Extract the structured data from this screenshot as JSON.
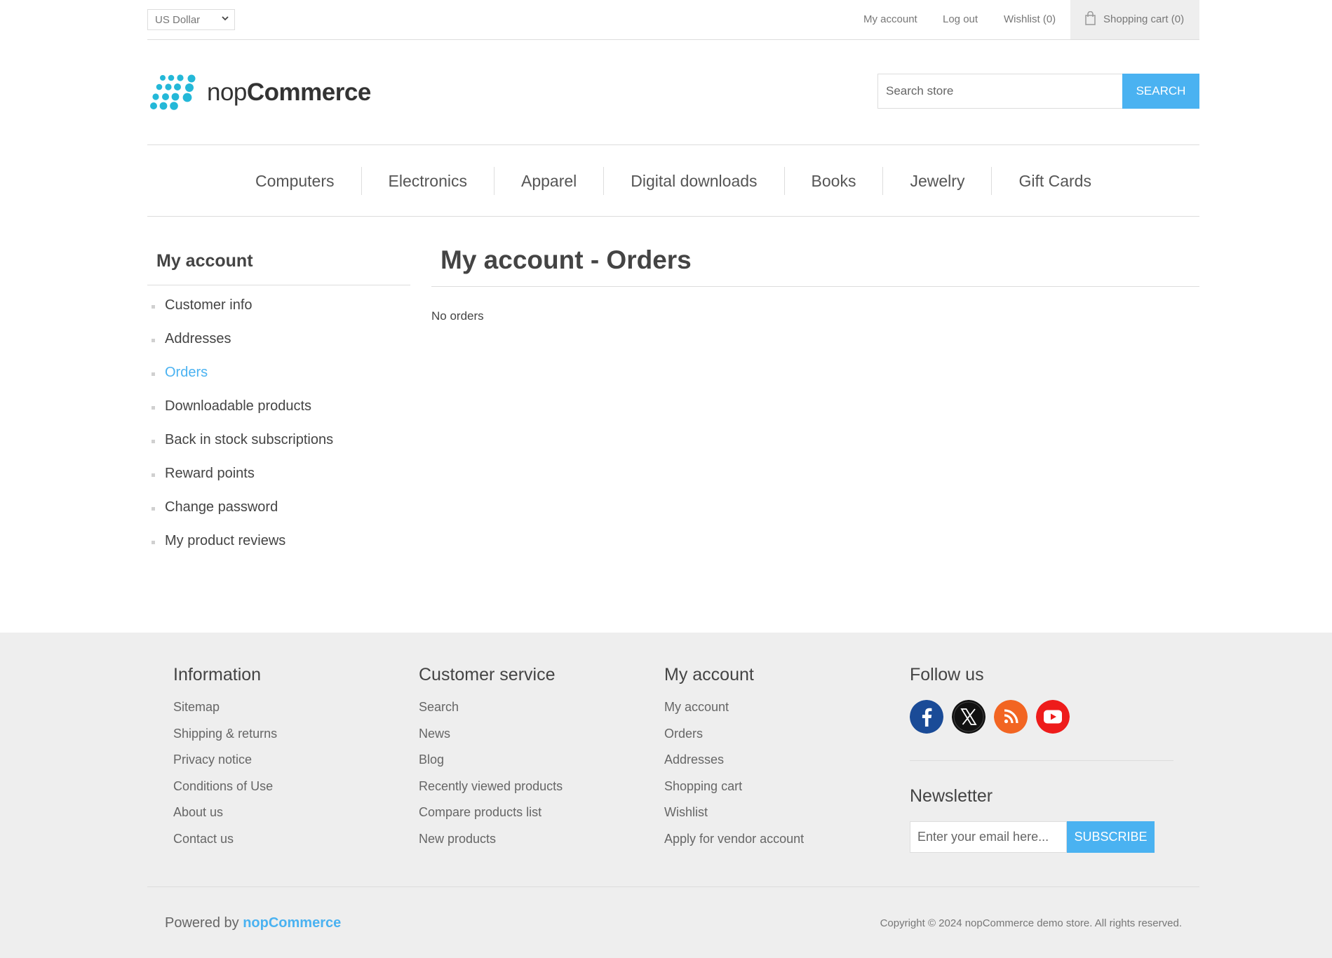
{
  "header_links": {
    "currency": "US Dollar",
    "my_account": "My account",
    "log_out": "Log out",
    "wishlist": "Wishlist (0)",
    "shopping_cart": "Shopping cart (0)"
  },
  "header": {
    "logo_prefix": "nop",
    "logo_suffix": "Commerce",
    "search_placeholder": "Search store",
    "search_button": "SEARCH"
  },
  "nav": [
    "Computers",
    "Electronics",
    "Apparel",
    "Digital downloads",
    "Books",
    "Jewelry",
    "Gift Cards"
  ],
  "sidebar": {
    "title": "My account",
    "items": [
      {
        "label": "Customer info",
        "active": false
      },
      {
        "label": "Addresses",
        "active": false
      },
      {
        "label": "Orders",
        "active": true
      },
      {
        "label": "Downloadable products",
        "active": false
      },
      {
        "label": "Back in stock subscriptions",
        "active": false
      },
      {
        "label": "Reward points",
        "active": false
      },
      {
        "label": "Change password",
        "active": false
      },
      {
        "label": "My product reviews",
        "active": false
      }
    ]
  },
  "main": {
    "title": "My account - Orders",
    "empty_message": "No orders"
  },
  "footer": {
    "information": {
      "title": "Information",
      "links": [
        "Sitemap",
        "Shipping & returns",
        "Privacy notice",
        "Conditions of Use",
        "About us",
        "Contact us"
      ]
    },
    "customer_service": {
      "title": "Customer service",
      "links": [
        "Search",
        "News",
        "Blog",
        "Recently viewed products",
        "Compare products list",
        "New products"
      ]
    },
    "my_account": {
      "title": "My account",
      "links": [
        "My account",
        "Orders",
        "Addresses",
        "Shopping cart",
        "Wishlist",
        "Apply for vendor account"
      ]
    },
    "follow_us": {
      "title": "Follow us",
      "icons": [
        "facebook-icon",
        "x-twitter-icon",
        "rss-icon",
        "youtube-icon"
      ]
    },
    "newsletter": {
      "title": "Newsletter",
      "placeholder": "Enter your email here...",
      "button": "SUBSCRIBE"
    },
    "powered_by": "Powered by",
    "powered_brand": "nopCommerce",
    "copyright": "Copyright © 2024 nopCommerce demo store. All rights reserved."
  },
  "colors": {
    "accent": "#4ab2f1",
    "logo_dots": "#24b8d8",
    "footer_bg": "#eeeeee",
    "facebook": "#1a4b97",
    "x_twitter": "#111111",
    "rss": "#f26522",
    "youtube": "#ee1c1b"
  }
}
